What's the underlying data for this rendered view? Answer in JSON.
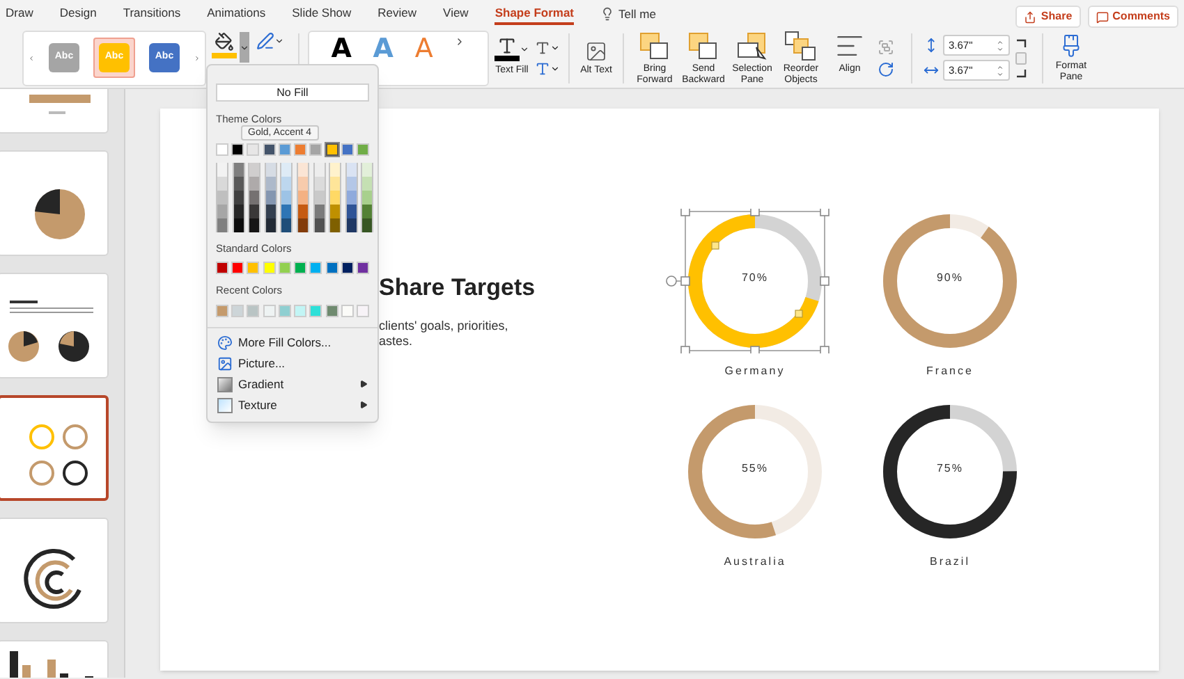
{
  "tabs": [
    {
      "label": "Draw",
      "selected": false
    },
    {
      "label": "Design",
      "selected": false
    },
    {
      "label": "Transitions",
      "selected": false
    },
    {
      "label": "Animations",
      "selected": false
    },
    {
      "label": "Slide Show",
      "selected": false
    },
    {
      "label": "Review",
      "selected": false
    },
    {
      "label": "View",
      "selected": false
    },
    {
      "label": "Shape Format",
      "selected": true
    }
  ],
  "tell_me": "Tell me",
  "share_button": "Share",
  "comments_button": "Comments",
  "ribbon": {
    "shape_styles": [
      {
        "label": "Abc",
        "color": "#a5a5a5",
        "selected": false
      },
      {
        "label": "Abc",
        "color": "#ffc000",
        "selected": true
      },
      {
        "label": "Abc",
        "color": "#4472c4",
        "selected": false
      }
    ],
    "shape_fill": {
      "color": "#ffc000",
      "expanded": true
    },
    "wordart_styles": [
      {
        "label": "A",
        "kind": "solid",
        "color": "#000000"
      },
      {
        "label": "A",
        "kind": "solid",
        "color": "#5b9bd5"
      },
      {
        "label": "A",
        "kind": "outline",
        "color": "#ed7d31"
      }
    ],
    "text_fill": {
      "label": "Text Fill",
      "color": "#000000"
    },
    "alt_text": "Alt Text",
    "arrange": [
      {
        "label": "Bring Forward",
        "kind": "bring"
      },
      {
        "label": "Send Backward",
        "kind": "send"
      },
      {
        "label": "Selection Pane",
        "kind": "pane"
      },
      {
        "label": "Reorder Objects",
        "kind": "reorder"
      },
      {
        "label": "Align",
        "kind": "align"
      }
    ],
    "height": "3.67\"",
    "width": "3.67\"",
    "format_pane": "Format Pane"
  },
  "fill_menu": {
    "no_fill": "No Fill",
    "theme_heading": "Theme Colors",
    "tooltip": "Gold, Accent 4",
    "theme_colors": [
      {
        "color": "#ffffff",
        "selected": false
      },
      {
        "color": "#000000",
        "selected": false
      },
      {
        "color": "#e7e6e6",
        "selected": false
      },
      {
        "color": "#44546a",
        "selected": false
      },
      {
        "color": "#5b9bd5",
        "selected": false
      },
      {
        "color": "#ed7d31",
        "selected": false
      },
      {
        "color": "#a5a5a5",
        "selected": false
      },
      {
        "color": "#ffc000",
        "selected": true
      },
      {
        "color": "#4472c4",
        "selected": false
      },
      {
        "color": "#70ad47",
        "selected": false
      }
    ],
    "shades": [
      {
        "color": "#f2f2f2"
      },
      {
        "color": "#7f7f7f"
      },
      {
        "color": "#d0cece"
      },
      {
        "color": "#d6dce4"
      },
      {
        "color": "#deebf6"
      },
      {
        "color": "#fbe5d5"
      },
      {
        "color": "#ededed"
      },
      {
        "color": "#fff2cc"
      },
      {
        "color": "#dae3f3"
      },
      {
        "color": "#e2efd9"
      },
      {
        "color": "#d9d9d9"
      },
      {
        "color": "#595959"
      },
      {
        "color": "#aeaaaa"
      },
      {
        "color": "#adb9ca"
      },
      {
        "color": "#bdd7ee"
      },
      {
        "color": "#f7cbac"
      },
      {
        "color": "#dbdbdb"
      },
      {
        "color": "#fee599"
      },
      {
        "color": "#b4c7e7"
      },
      {
        "color": "#c5e0b3"
      },
      {
        "color": "#bfbfbf"
      },
      {
        "color": "#404040"
      },
      {
        "color": "#757171"
      },
      {
        "color": "#8496b0"
      },
      {
        "color": "#9dc3e6"
      },
      {
        "color": "#f4b183"
      },
      {
        "color": "#c9c9c9"
      },
      {
        "color": "#ffd965"
      },
      {
        "color": "#8faadc"
      },
      {
        "color": "#a8d08d"
      },
      {
        "color": "#a6a6a6"
      },
      {
        "color": "#262626"
      },
      {
        "color": "#3a3838"
      },
      {
        "color": "#333f4f"
      },
      {
        "color": "#2e75b5"
      },
      {
        "color": "#c55a11"
      },
      {
        "color": "#7b7b7b"
      },
      {
        "color": "#bf9000"
      },
      {
        "color": "#2f5496"
      },
      {
        "color": "#538135"
      },
      {
        "color": "#808080"
      },
      {
        "color": "#0d0d0d"
      },
      {
        "color": "#171616"
      },
      {
        "color": "#222a35"
      },
      {
        "color": "#1f4e79"
      },
      {
        "color": "#833c0b"
      },
      {
        "color": "#525252"
      },
      {
        "color": "#7f6000"
      },
      {
        "color": "#1f3864"
      },
      {
        "color": "#375623"
      }
    ],
    "standard_heading": "Standard Colors",
    "standard_colors": [
      {
        "color": "#c00000"
      },
      {
        "color": "#ff0000"
      },
      {
        "color": "#ffc000"
      },
      {
        "color": "#ffff00"
      },
      {
        "color": "#92d050"
      },
      {
        "color": "#00b050"
      },
      {
        "color": "#00b0f0"
      },
      {
        "color": "#0070c0"
      },
      {
        "color": "#002060"
      },
      {
        "color": "#7030a0"
      }
    ],
    "recent_heading": "Recent Colors",
    "recent_colors": [
      {
        "color": "#c49a6c"
      },
      {
        "color": "#cdd5d8"
      },
      {
        "color": "#b9c4c4"
      },
      {
        "color": "#eef3f3"
      },
      {
        "color": "#8fcfd1"
      },
      {
        "color": "#c2f5f5"
      },
      {
        "color": "#2ee0d8"
      },
      {
        "color": "#6f8a6f"
      },
      {
        "color": "#fbfbf8"
      },
      {
        "color": "#f7f3f7"
      }
    ],
    "items": [
      {
        "label": "More Fill Colors...",
        "kind": "palette",
        "submenu": false
      },
      {
        "label": "Picture...",
        "kind": "picture",
        "submenu": false
      },
      {
        "label": "Gradient",
        "kind": "gradient",
        "submenu": true
      },
      {
        "label": "Texture",
        "kind": "texture",
        "submenu": true
      }
    ]
  },
  "slides": [
    {
      "kind": "bars",
      "selected": false
    },
    {
      "kind": "pie",
      "selected": false
    },
    {
      "kind": "pies",
      "selected": false
    },
    {
      "kind": "donuts",
      "selected": true
    },
    {
      "kind": "rings",
      "selected": false
    },
    {
      "kind": "columns",
      "selected": false
    }
  ],
  "slide": {
    "title": "Share Targets",
    "body_lines": [
      "clients' goals, priorities,",
      "astes."
    ]
  },
  "donuts": [
    {
      "label": "Germany",
      "reading": "70%",
      "level": 0.7,
      "color": "#ffc000",
      "kind": "gray",
      "selected": true
    },
    {
      "label": "France",
      "reading": "90%",
      "level": 0.9,
      "color": "#c49a6c",
      "kind": "beige",
      "selected": false
    },
    {
      "label": "Australia",
      "reading": "55%",
      "level": 0.55,
      "color": "#c49a6c",
      "kind": "beige",
      "selected": false
    },
    {
      "label": "Brazil",
      "reading": "75%",
      "level": 0.75,
      "color": "#262626",
      "kind": "gray",
      "selected": false
    }
  ]
}
